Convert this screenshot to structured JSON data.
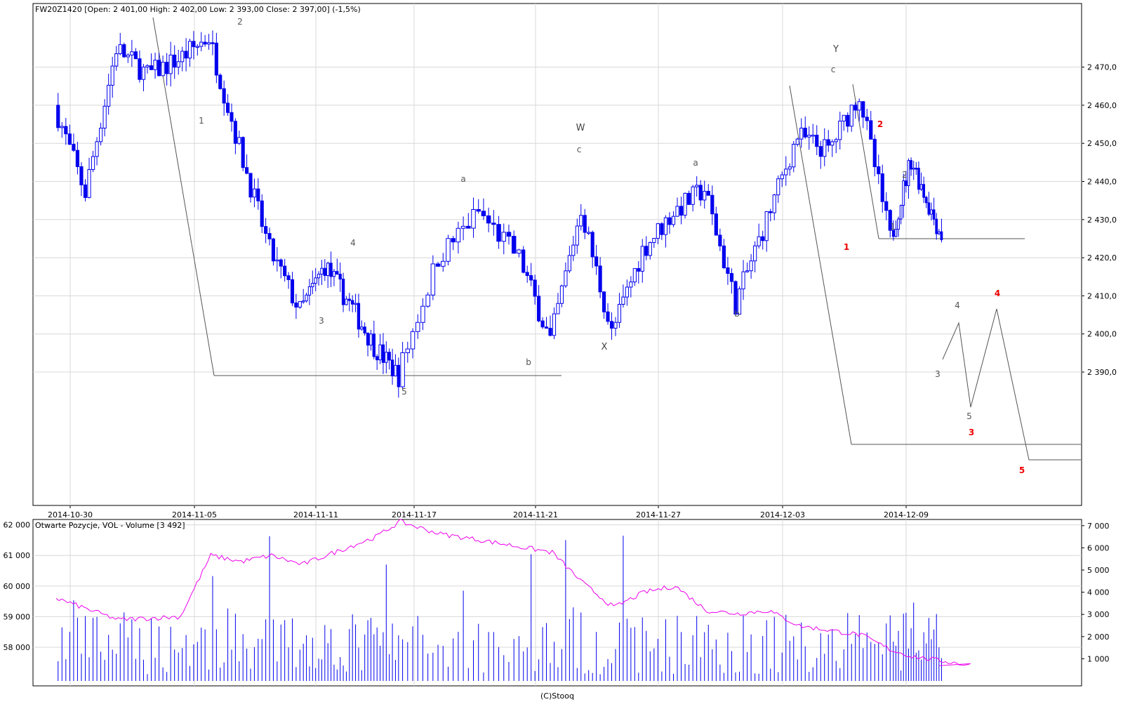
{
  "header": {
    "main_title": "FW20Z1420 [Open: 2 401,00  High: 2 402,00  Low: 2 393,00  Close: 2 397,00] (-1,5%)",
    "lower_title": "Otwarte Pozycje, VOL - Volume [3 492]",
    "footer": "(C)Stooq"
  },
  "colors": {
    "candle": "#0000ee",
    "open_interest": "#ee00ee",
    "volume": "#0000ee",
    "grid": "#d8d8d8",
    "wave_red": "#ee0000",
    "wave_gray": "#555555"
  },
  "chart_data": [
    {
      "type": "candlestick",
      "symbol": "FW20Z1420",
      "x_ticks": [
        "2014-10-30",
        "2014-11-05",
        "2014-11-11",
        "2014-11-17",
        "2014-11-21",
        "2014-11-27",
        "2014-12-03",
        "2014-12-09"
      ],
      "y_ticks": [
        "2 390,0",
        "2 400,0",
        "2 410,0",
        "2 420,0",
        "2 430,0",
        "2 440,0",
        "2 450,0",
        "2 460,0",
        "2 470,0"
      ],
      "y_tick_values": [
        2390,
        2400,
        2410,
        2420,
        2430,
        2440,
        2450,
        2460,
        2470
      ],
      "grid": true,
      "last_ohlc": {
        "open": 2401,
        "high": 2402,
        "low": 2393,
        "close": 2397
      },
      "daily_waypoints": [
        {
          "date": "2014-10-30",
          "value": 2460
        },
        {
          "date": "2014-10-31",
          "value": 2437
        },
        {
          "date": "2014-11-03",
          "value": 2475
        },
        {
          "date": "2014-11-04",
          "value": 2468
        },
        {
          "date": "2014-11-05",
          "value": 2472
        },
        {
          "date": "2014-11-06",
          "value": 2478
        },
        {
          "date": "2014-11-07",
          "value": 2449
        },
        {
          "date": "2014-11-10",
          "value": 2422
        },
        {
          "date": "2014-11-11",
          "value": 2406
        },
        {
          "date": "2014-11-12",
          "value": 2418
        },
        {
          "date": "2014-11-13",
          "value": 2408
        },
        {
          "date": "2014-11-14",
          "value": 2397
        },
        {
          "date": "2014-11-17",
          "value": 2389
        },
        {
          "date": "2014-11-18",
          "value": 2420
        },
        {
          "date": "2014-11-19",
          "value": 2432
        },
        {
          "date": "2014-11-20",
          "value": 2420
        },
        {
          "date": "2014-11-21",
          "value": 2398
        },
        {
          "date": "2014-11-24",
          "value": 2433
        },
        {
          "date": "2014-11-25",
          "value": 2400
        },
        {
          "date": "2014-11-26",
          "value": 2422
        },
        {
          "date": "2014-11-27",
          "value": 2432
        },
        {
          "date": "2014-11-28",
          "value": 2438
        },
        {
          "date": "2014-12-01",
          "value": 2408
        },
        {
          "date": "2014-12-02",
          "value": 2430
        },
        {
          "date": "2014-12-03",
          "value": 2452
        },
        {
          "date": "2014-12-04",
          "value": 2448
        },
        {
          "date": "2014-12-05",
          "value": 2463
        },
        {
          "date": "2014-12-08",
          "value": 2425
        },
        {
          "date": "2014-12-09",
          "value": 2446
        },
        {
          "date": "2014-12-10",
          "value": 2432
        },
        {
          "date": "2014-12-11",
          "value": 2420
        },
        {
          "date": "2014-12-12",
          "value": 2397
        }
      ],
      "annotations": [
        {
          "text": "1",
          "series": "gray"
        },
        {
          "text": "2",
          "series": "gray"
        },
        {
          "text": "3",
          "series": "gray"
        },
        {
          "text": "4",
          "series": "gray"
        },
        {
          "text": "5",
          "series": "gray"
        },
        {
          "text": "a",
          "series": "gray"
        },
        {
          "text": "b",
          "series": "gray"
        },
        {
          "text": "c",
          "series": "gray"
        },
        {
          "text": "W",
          "series": "gray"
        },
        {
          "text": "X",
          "series": "gray"
        },
        {
          "text": "a",
          "series": "gray"
        },
        {
          "text": "b",
          "series": "gray"
        },
        {
          "text": "c",
          "series": "gray"
        },
        {
          "text": "Y",
          "series": "gray"
        },
        {
          "text": "1",
          "series": "red"
        },
        {
          "text": "2",
          "series": "red"
        },
        {
          "text": "1",
          "series": "gray"
        },
        {
          "text": "2",
          "series": "gray"
        },
        {
          "text": "3",
          "series": "gray"
        },
        {
          "text": "4",
          "series": "gray"
        },
        {
          "text": "5",
          "series": "gray"
        },
        {
          "text": "3",
          "series": "red"
        },
        {
          "text": "4",
          "series": "red"
        },
        {
          "text": "5",
          "series": "red"
        }
      ]
    },
    {
      "type": "line_and_bar",
      "left_axis_ticks": [
        "58 000",
        "59 000",
        "60 000",
        "61 000",
        "62 000"
      ],
      "left_axis_values": [
        58000,
        59000,
        60000,
        61000,
        62000
      ],
      "right_axis_ticks": [
        "1 000",
        "2 000",
        "3 000",
        "4 000",
        "5 000",
        "6 000",
        "7 000"
      ],
      "right_axis_values": [
        1000,
        2000,
        3000,
        4000,
        5000,
        6000,
        7000
      ],
      "last_volume": 3492,
      "open_interest_waypoints": [
        {
          "date": "2014-10-30",
          "value": 59600
        },
        {
          "date": "2014-11-03",
          "value": 58900
        },
        {
          "date": "2014-11-05",
          "value": 59000
        },
        {
          "date": "2014-11-06",
          "value": 61000
        },
        {
          "date": "2014-11-07",
          "value": 60800
        },
        {
          "date": "2014-11-10",
          "value": 61000
        },
        {
          "date": "2014-11-11",
          "value": 60700
        },
        {
          "date": "2014-11-12",
          "value": 61000
        },
        {
          "date": "2014-11-14",
          "value": 61600
        },
        {
          "date": "2014-11-17",
          "value": 62100
        },
        {
          "date": "2014-11-18",
          "value": 61700
        },
        {
          "date": "2014-11-19",
          "value": 61500
        },
        {
          "date": "2014-11-21",
          "value": 61100
        },
        {
          "date": "2014-11-24",
          "value": 60100
        },
        {
          "date": "2014-11-25",
          "value": 59300
        },
        {
          "date": "2014-11-26",
          "value": 59800
        },
        {
          "date": "2014-11-27",
          "value": 60000
        },
        {
          "date": "2014-11-28",
          "value": 59200
        },
        {
          "date": "2014-12-01",
          "value": 59100
        },
        {
          "date": "2014-12-02",
          "value": 59200
        },
        {
          "date": "2014-12-03",
          "value": 58700
        },
        {
          "date": "2014-12-05",
          "value": 58400
        },
        {
          "date": "2014-12-08",
          "value": 57900
        },
        {
          "date": "2014-12-09",
          "value": 57700
        },
        {
          "date": "2014-12-12",
          "value": 57400
        }
      ]
    }
  ]
}
